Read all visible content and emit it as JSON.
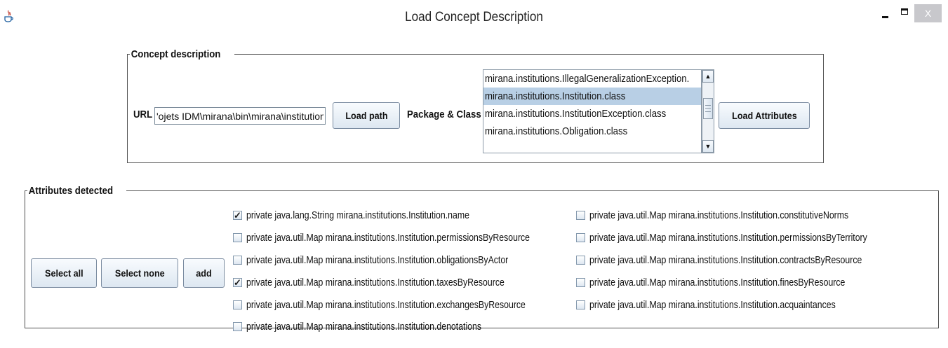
{
  "window": {
    "title": "Load Concept Description",
    "icon": "java-app-icon",
    "close_label": "X"
  },
  "concept": {
    "legend": "Concept description",
    "url_label": "URL",
    "url_value": "'ojets IDM\\mirana\\bin\\mirana\\institutions",
    "load_path_label": "Load path",
    "package_label": "Package & Class",
    "classes": [
      {
        "label": "mirana.institutions.IllegalGeneralizationException.",
        "selected": false
      },
      {
        "label": "mirana.institutions.Institution.class",
        "selected": true
      },
      {
        "label": "mirana.institutions.InstitutionException.class",
        "selected": false
      },
      {
        "label": "mirana.institutions.Obligation.class",
        "selected": false
      }
    ],
    "load_attributes_label": "Load Attributes"
  },
  "attributes": {
    "legend": "Attributes detected",
    "select_all_label": "Select all",
    "select_none_label": "Select none",
    "add_label": "add",
    "left": [
      {
        "label": "private java.lang.String mirana.institutions.Institution.name",
        "checked": true
      },
      {
        "label": "private java.util.Map mirana.institutions.Institution.permissionsByResource",
        "checked": false
      },
      {
        "label": "private java.util.Map mirana.institutions.Institution.obligationsByActor",
        "checked": false
      },
      {
        "label": "private java.util.Map mirana.institutions.Institution.taxesByResource",
        "checked": true
      },
      {
        "label": "private java.util.Map mirana.institutions.Institution.exchangesByResource",
        "checked": false
      },
      {
        "label": "private java.util.Map mirana.institutions.Institution.denotations",
        "checked": false
      }
    ],
    "right": [
      {
        "label": "private java.util.Map mirana.institutions.Institution.constitutiveNorms",
        "checked": false
      },
      {
        "label": "private java.util.Map mirana.institutions.Institution.permissionsByTerritory",
        "checked": false
      },
      {
        "label": "private java.util.Map mirana.institutions.Institution.contractsByResource",
        "checked": false
      },
      {
        "label": "private java.util.Map mirana.institutions.Institution.finesByResource",
        "checked": false
      },
      {
        "label": "private java.util.Map mirana.institutions.Institution.acquaintances",
        "checked": false
      }
    ]
  }
}
